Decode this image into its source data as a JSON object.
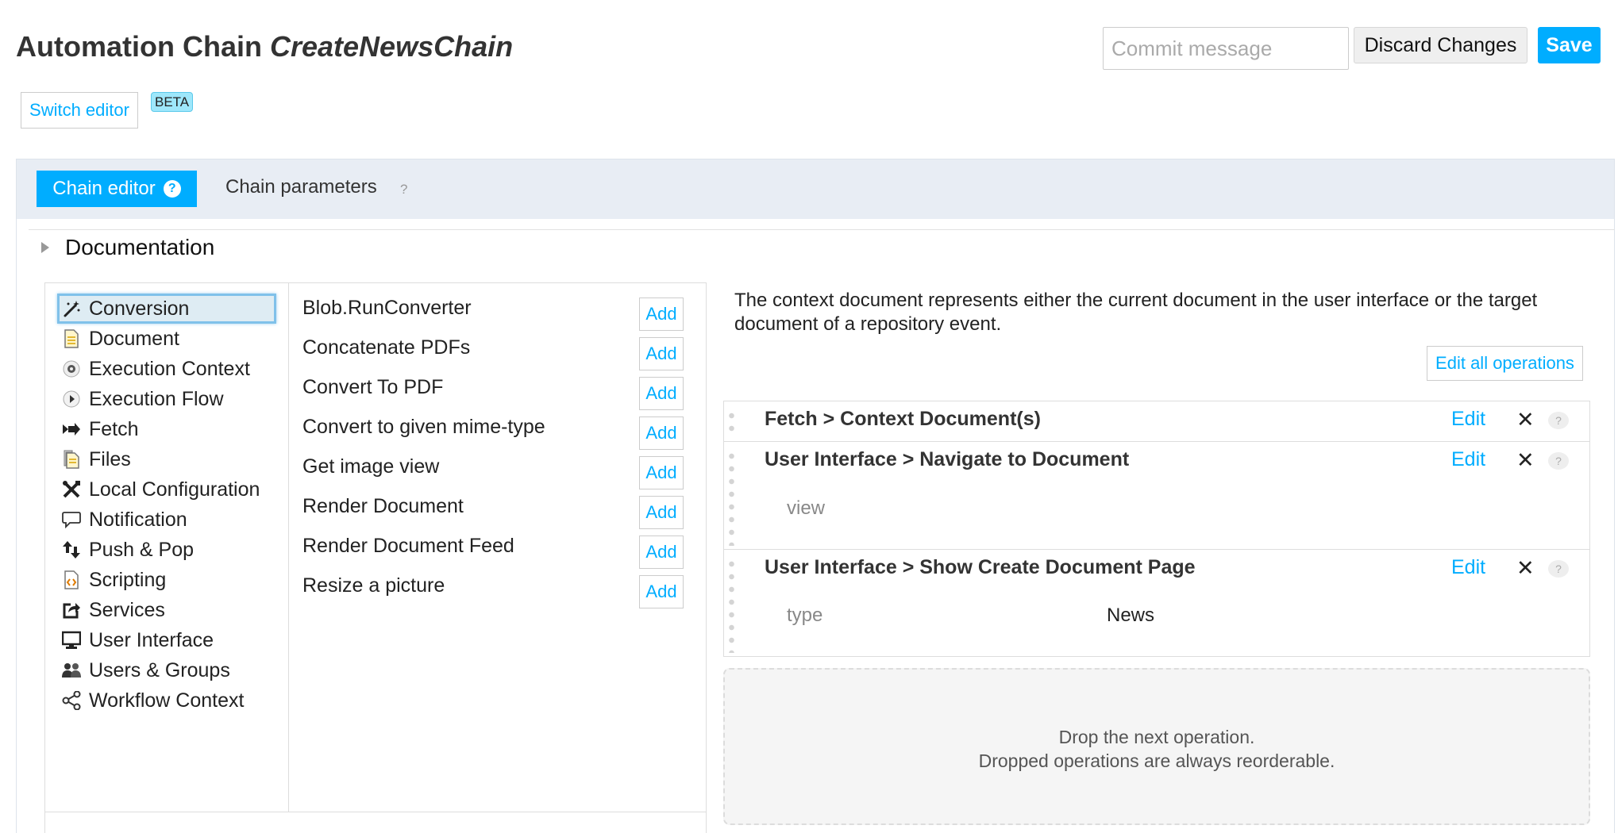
{
  "header": {
    "title_prefix": "Automation Chain",
    "title_name": "CreateNewsChain",
    "commit_placeholder": "Commit message",
    "discard_label": "Discard Changes",
    "save_label": "Save",
    "switch_editor_label": "Switch editor",
    "beta_label": "BETA"
  },
  "tabs": [
    {
      "label": "Chain editor",
      "help": "?",
      "active": true
    },
    {
      "label": "Chain parameters",
      "help": "?",
      "active": false
    }
  ],
  "documentation_label": "Documentation",
  "categories": [
    {
      "label": "Conversion",
      "icon": "magic-wand-icon",
      "selected": true
    },
    {
      "label": "Document",
      "icon": "document-icon"
    },
    {
      "label": "Execution Context",
      "icon": "gear-icon"
    },
    {
      "label": "Execution Flow",
      "icon": "play-icon"
    },
    {
      "label": "Fetch",
      "icon": "fetch-arrow-icon"
    },
    {
      "label": "Files",
      "icon": "files-icon"
    },
    {
      "label": "Local Configuration",
      "icon": "tools-icon"
    },
    {
      "label": "Notification",
      "icon": "speech-bubble-icon"
    },
    {
      "label": "Push & Pop",
      "icon": "push-pop-arrows-icon"
    },
    {
      "label": "Scripting",
      "icon": "script-icon"
    },
    {
      "label": "Services",
      "icon": "share-out-icon"
    },
    {
      "label": "User Interface",
      "icon": "monitor-icon"
    },
    {
      "label": "Users & Groups",
      "icon": "users-icon"
    },
    {
      "label": "Workflow Context",
      "icon": "share-nodes-icon"
    }
  ],
  "operations": [
    {
      "name": "Blob.RunConverter",
      "add_label": "Add"
    },
    {
      "name": "Concatenate PDFs",
      "add_label": "Add"
    },
    {
      "name": "Convert To PDF",
      "add_label": "Add"
    },
    {
      "name": "Convert to given mime-type",
      "add_label": "Add"
    },
    {
      "name": "Get image view",
      "add_label": "Add"
    },
    {
      "name": "Render Document",
      "add_label": "Add"
    },
    {
      "name": "Render Document Feed",
      "add_label": "Add"
    },
    {
      "name": "Resize a picture",
      "add_label": "Add"
    }
  ],
  "chain": {
    "context_text": "The context document represents either the current document in the user interface or the target document of a repository event.",
    "edit_all_label": "Edit all operations",
    "ops": [
      {
        "title": "Fetch > Context Document(s)",
        "edit_label": "Edit",
        "delete_symbol": "✕",
        "help": "?",
        "params": []
      },
      {
        "title": "User Interface > Navigate to Document",
        "edit_label": "Edit",
        "delete_symbol": "✕",
        "help": "?",
        "params": [
          {
            "name": "view",
            "value": ""
          }
        ]
      },
      {
        "title": "User Interface > Show Create Document Page",
        "edit_label": "Edit",
        "delete_symbol": "✕",
        "help": "?",
        "params": [
          {
            "name": "type",
            "value": "News"
          }
        ]
      }
    ],
    "drop_line1": "Drop the next operation.",
    "drop_line2": "Dropped operations are always reorderable."
  },
  "colors": {
    "accent": "#00adff",
    "tabbar_bg": "#e8edf4",
    "selected_bg": "#deecf3"
  }
}
